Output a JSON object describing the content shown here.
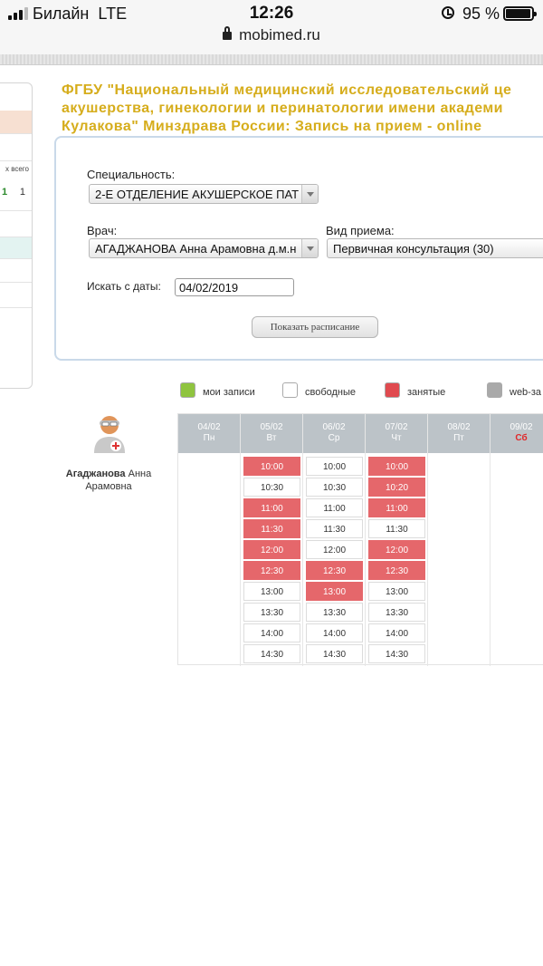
{
  "status_bar": {
    "carrier": "Билайн",
    "network": "LTE",
    "time": "12:26",
    "battery": "95 %",
    "url": "mobimed.ru"
  },
  "side_panel": {
    "header_text": "х всего",
    "value_green": "1",
    "value_total": "1"
  },
  "title_lines": [
    "ФГБУ \"Национальный медицинский исследовательский це",
    "акушерства, гинекологии и перинатологии имени академи",
    "Кулакова\" Минздрава России: Запись на прием - online"
  ],
  "form": {
    "specialty_label": "Специальность:",
    "specialty_value": "2-Е ОТДЕЛЕНИЕ АКУШЕРСКОЕ ПАТ",
    "doctor_label": "Врач:",
    "doctor_value": "АГАДЖАНОВА Анна Арамовна д.м.н",
    "visit_type_label": "Вид приема:",
    "visit_type_value": "Первичная консультация (30)",
    "date_label": "Искать с даты:",
    "date_value": "04/02/2019",
    "show_button": "Показать расписание"
  },
  "legend": [
    {
      "label": "мои записи",
      "color": "#8fc43f"
    },
    {
      "label": "свободные",
      "color": "#ffffff"
    },
    {
      "label": "занятые",
      "color": "#e04a4f"
    },
    {
      "label": "web-за",
      "color": "#a9a9a9"
    }
  ],
  "doctor": {
    "last_name": "Агаджанова",
    "first_name": "Анна",
    "patronymic": "Арамовна"
  },
  "colors": {
    "title": "#d6ad1c",
    "busy": "#e5676b",
    "header": "#bcc3c8",
    "weekend": "#e0282a"
  },
  "schedule": [
    {
      "date": "04/02",
      "weekday": "Пн",
      "weekend": false,
      "slots": []
    },
    {
      "date": "05/02",
      "weekday": "Вт",
      "weekend": false,
      "slots": [
        {
          "time": "10:00",
          "busy": true
        },
        {
          "time": "10:30",
          "busy": false
        },
        {
          "time": "11:00",
          "busy": true
        },
        {
          "time": "11:30",
          "busy": true
        },
        {
          "time": "12:00",
          "busy": true
        },
        {
          "time": "12:30",
          "busy": true
        },
        {
          "time": "13:00",
          "busy": false
        },
        {
          "time": "13:30",
          "busy": false
        },
        {
          "time": "14:00",
          "busy": false
        },
        {
          "time": "14:30",
          "busy": false
        }
      ]
    },
    {
      "date": "06/02",
      "weekday": "Ср",
      "weekend": false,
      "slots": [
        {
          "time": "10:00",
          "busy": false
        },
        {
          "time": "10:30",
          "busy": false
        },
        {
          "time": "11:00",
          "busy": false
        },
        {
          "time": "11:30",
          "busy": false
        },
        {
          "time": "12:00",
          "busy": false
        },
        {
          "time": "12:30",
          "busy": true
        },
        {
          "time": "13:00",
          "busy": true
        },
        {
          "time": "13:30",
          "busy": false
        },
        {
          "time": "14:00",
          "busy": false
        },
        {
          "time": "14:30",
          "busy": false
        }
      ]
    },
    {
      "date": "07/02",
      "weekday": "Чт",
      "weekend": false,
      "slots": [
        {
          "time": "10:00",
          "busy": true
        },
        {
          "time": "10:20",
          "busy": true
        },
        {
          "time": "11:00",
          "busy": true
        },
        {
          "time": "11:30",
          "busy": false
        },
        {
          "time": "12:00",
          "busy": true
        },
        {
          "time": "12:30",
          "busy": true
        },
        {
          "time": "13:00",
          "busy": false
        },
        {
          "time": "13:30",
          "busy": false
        },
        {
          "time": "14:00",
          "busy": false
        },
        {
          "time": "14:30",
          "busy": false
        }
      ]
    },
    {
      "date": "08/02",
      "weekday": "Пт",
      "weekend": false,
      "slots": []
    },
    {
      "date": "09/02",
      "weekday": "Сб",
      "weekend": true,
      "slots": []
    }
  ]
}
